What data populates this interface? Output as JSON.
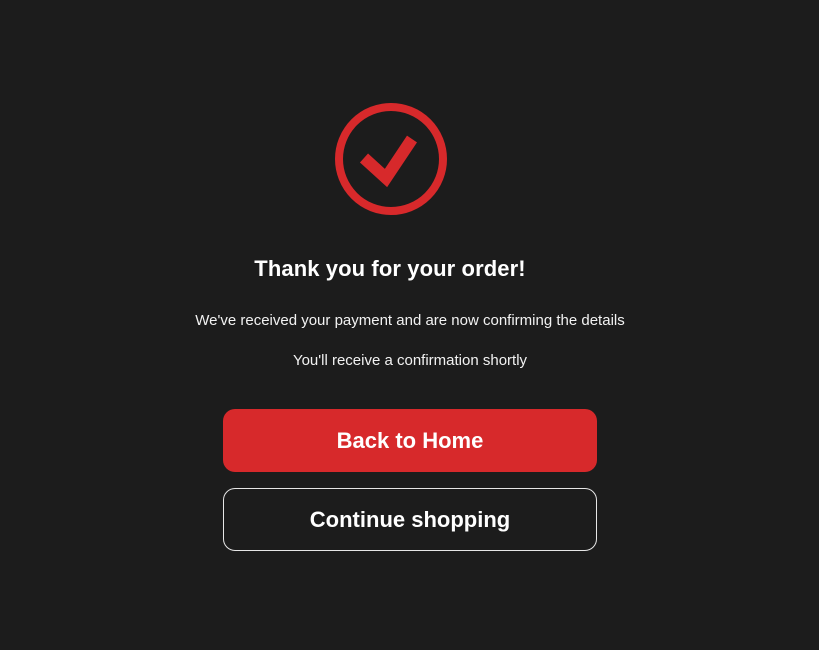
{
  "confirmation": {
    "icon": "check-circle-icon",
    "accent_color": "#d7292b",
    "title": "Thank you for your order!",
    "message_line_1": "We've received your payment and are now confirming the details",
    "message_line_2": "You'll receive a confirmation shortly"
  },
  "actions": {
    "primary_label": "Back to Home",
    "secondary_label": "Continue shopping"
  }
}
